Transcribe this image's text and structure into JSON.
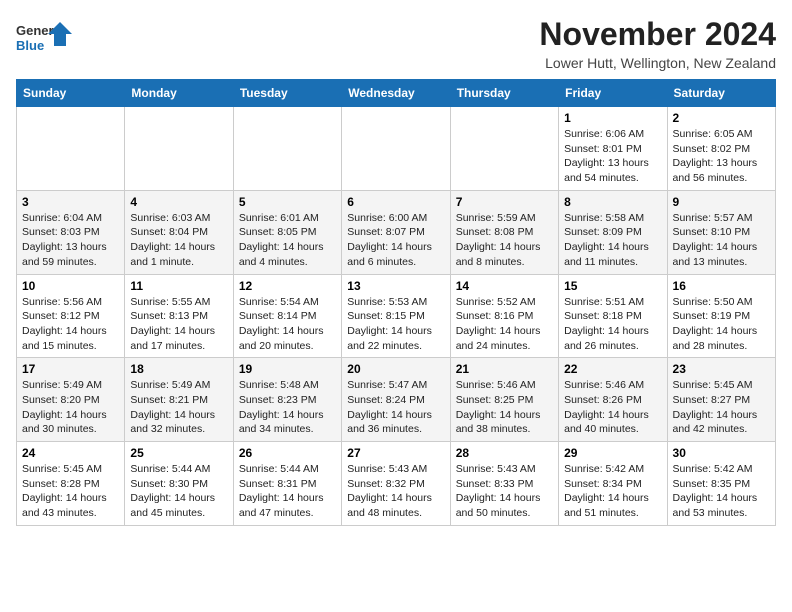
{
  "logo": {
    "line1": "General",
    "line2": "Blue"
  },
  "title": "November 2024",
  "location": "Lower Hutt, Wellington, New Zealand",
  "weekdays": [
    "Sunday",
    "Monday",
    "Tuesday",
    "Wednesday",
    "Thursday",
    "Friday",
    "Saturday"
  ],
  "weeks": [
    [
      {
        "day": "",
        "info": ""
      },
      {
        "day": "",
        "info": ""
      },
      {
        "day": "",
        "info": ""
      },
      {
        "day": "",
        "info": ""
      },
      {
        "day": "",
        "info": ""
      },
      {
        "day": "1",
        "info": "Sunrise: 6:06 AM\nSunset: 8:01 PM\nDaylight: 13 hours and 54 minutes."
      },
      {
        "day": "2",
        "info": "Sunrise: 6:05 AM\nSunset: 8:02 PM\nDaylight: 13 hours and 56 minutes."
      }
    ],
    [
      {
        "day": "3",
        "info": "Sunrise: 6:04 AM\nSunset: 8:03 PM\nDaylight: 13 hours and 59 minutes."
      },
      {
        "day": "4",
        "info": "Sunrise: 6:03 AM\nSunset: 8:04 PM\nDaylight: 14 hours and 1 minute."
      },
      {
        "day": "5",
        "info": "Sunrise: 6:01 AM\nSunset: 8:05 PM\nDaylight: 14 hours and 4 minutes."
      },
      {
        "day": "6",
        "info": "Sunrise: 6:00 AM\nSunset: 8:07 PM\nDaylight: 14 hours and 6 minutes."
      },
      {
        "day": "7",
        "info": "Sunrise: 5:59 AM\nSunset: 8:08 PM\nDaylight: 14 hours and 8 minutes."
      },
      {
        "day": "8",
        "info": "Sunrise: 5:58 AM\nSunset: 8:09 PM\nDaylight: 14 hours and 11 minutes."
      },
      {
        "day": "9",
        "info": "Sunrise: 5:57 AM\nSunset: 8:10 PM\nDaylight: 14 hours and 13 minutes."
      }
    ],
    [
      {
        "day": "10",
        "info": "Sunrise: 5:56 AM\nSunset: 8:12 PM\nDaylight: 14 hours and 15 minutes."
      },
      {
        "day": "11",
        "info": "Sunrise: 5:55 AM\nSunset: 8:13 PM\nDaylight: 14 hours and 17 minutes."
      },
      {
        "day": "12",
        "info": "Sunrise: 5:54 AM\nSunset: 8:14 PM\nDaylight: 14 hours and 20 minutes."
      },
      {
        "day": "13",
        "info": "Sunrise: 5:53 AM\nSunset: 8:15 PM\nDaylight: 14 hours and 22 minutes."
      },
      {
        "day": "14",
        "info": "Sunrise: 5:52 AM\nSunset: 8:16 PM\nDaylight: 14 hours and 24 minutes."
      },
      {
        "day": "15",
        "info": "Sunrise: 5:51 AM\nSunset: 8:18 PM\nDaylight: 14 hours and 26 minutes."
      },
      {
        "day": "16",
        "info": "Sunrise: 5:50 AM\nSunset: 8:19 PM\nDaylight: 14 hours and 28 minutes."
      }
    ],
    [
      {
        "day": "17",
        "info": "Sunrise: 5:49 AM\nSunset: 8:20 PM\nDaylight: 14 hours and 30 minutes."
      },
      {
        "day": "18",
        "info": "Sunrise: 5:49 AM\nSunset: 8:21 PM\nDaylight: 14 hours and 32 minutes."
      },
      {
        "day": "19",
        "info": "Sunrise: 5:48 AM\nSunset: 8:23 PM\nDaylight: 14 hours and 34 minutes."
      },
      {
        "day": "20",
        "info": "Sunrise: 5:47 AM\nSunset: 8:24 PM\nDaylight: 14 hours and 36 minutes."
      },
      {
        "day": "21",
        "info": "Sunrise: 5:46 AM\nSunset: 8:25 PM\nDaylight: 14 hours and 38 minutes."
      },
      {
        "day": "22",
        "info": "Sunrise: 5:46 AM\nSunset: 8:26 PM\nDaylight: 14 hours and 40 minutes."
      },
      {
        "day": "23",
        "info": "Sunrise: 5:45 AM\nSunset: 8:27 PM\nDaylight: 14 hours and 42 minutes."
      }
    ],
    [
      {
        "day": "24",
        "info": "Sunrise: 5:45 AM\nSunset: 8:28 PM\nDaylight: 14 hours and 43 minutes."
      },
      {
        "day": "25",
        "info": "Sunrise: 5:44 AM\nSunset: 8:30 PM\nDaylight: 14 hours and 45 minutes."
      },
      {
        "day": "26",
        "info": "Sunrise: 5:44 AM\nSunset: 8:31 PM\nDaylight: 14 hours and 47 minutes."
      },
      {
        "day": "27",
        "info": "Sunrise: 5:43 AM\nSunset: 8:32 PM\nDaylight: 14 hours and 48 minutes."
      },
      {
        "day": "28",
        "info": "Sunrise: 5:43 AM\nSunset: 8:33 PM\nDaylight: 14 hours and 50 minutes."
      },
      {
        "day": "29",
        "info": "Sunrise: 5:42 AM\nSunset: 8:34 PM\nDaylight: 14 hours and 51 minutes."
      },
      {
        "day": "30",
        "info": "Sunrise: 5:42 AM\nSunset: 8:35 PM\nDaylight: 14 hours and 53 minutes."
      }
    ]
  ]
}
